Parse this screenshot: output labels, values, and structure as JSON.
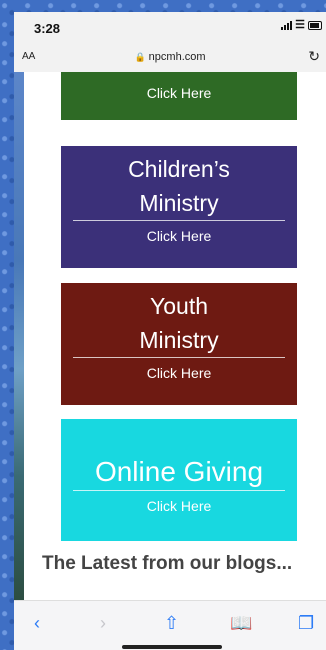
{
  "status_bar": {
    "time": "3:28"
  },
  "url_bar": {
    "aa_label": "AA",
    "url": "npcmh.com"
  },
  "tiles": [
    {
      "title": "",
      "cta": "Click Here",
      "color": "#2e6a25"
    },
    {
      "title_line1": "Children’s",
      "title_line2": "Ministry",
      "cta": "Click Here",
      "color": "#3b3079"
    },
    {
      "title_line1": "Youth",
      "title_line2": "Ministry",
      "cta": "Click Here",
      "color": "#6e1a12"
    },
    {
      "title": "Online Giving",
      "cta": "Click Here",
      "color": "#18d8e0"
    }
  ],
  "blogs": {
    "heading": "The Latest from our blogs..."
  },
  "toolbar": {
    "icons": [
      "back-icon",
      "forward-icon",
      "share-icon",
      "bookmarks-icon",
      "tabs-icon"
    ],
    "accent": "#2d7cf6"
  }
}
